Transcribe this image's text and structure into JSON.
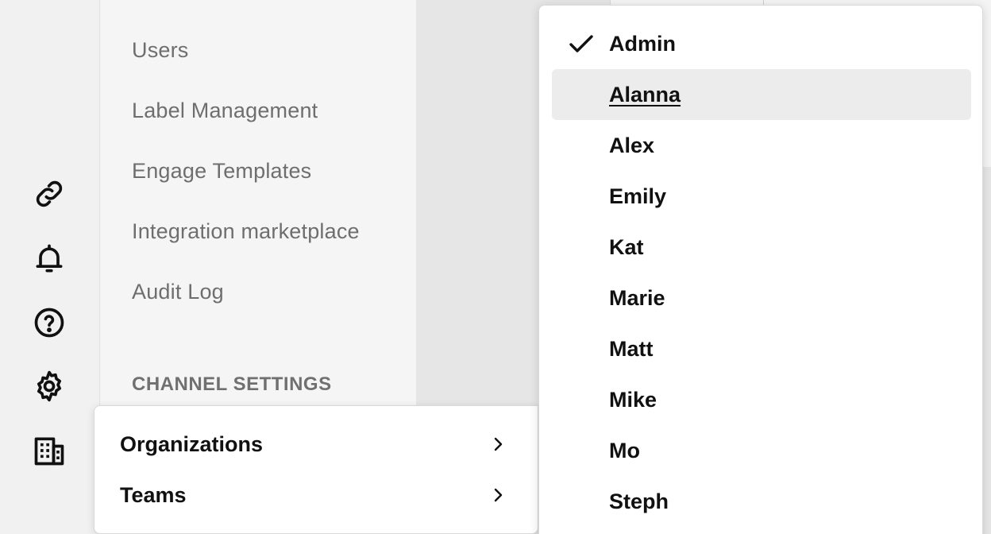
{
  "settings_menu": {
    "items": [
      {
        "label": "Users"
      },
      {
        "label": "Label Management"
      },
      {
        "label": "Engage Templates"
      },
      {
        "label": "Integration marketplace"
      },
      {
        "label": "Audit Log"
      }
    ],
    "section_heading": "CHANNEL SETTINGS"
  },
  "rail": {
    "icons": [
      "link-icon",
      "bell-icon",
      "help-icon",
      "gear-icon",
      "building-icon"
    ]
  },
  "submenu": {
    "items": [
      {
        "label": "Organizations",
        "icon": "chevron-right-icon"
      },
      {
        "label": "Teams",
        "icon": "chevron-right-icon"
      }
    ]
  },
  "user_dropdown": {
    "selected": "Admin",
    "hovered": "Alanna",
    "options": [
      {
        "label": "Admin"
      },
      {
        "label": "Alanna"
      },
      {
        "label": "Alex"
      },
      {
        "label": "Emily"
      },
      {
        "label": "Kat"
      },
      {
        "label": "Marie"
      },
      {
        "label": "Matt"
      },
      {
        "label": "Mike"
      },
      {
        "label": "Mo"
      },
      {
        "label": "Steph"
      }
    ]
  },
  "colors": {
    "text_primary": "#111111",
    "text_muted": "#6e6e6e",
    "hover_bg": "#ececec",
    "panel_bg": "#f5f5f5"
  }
}
